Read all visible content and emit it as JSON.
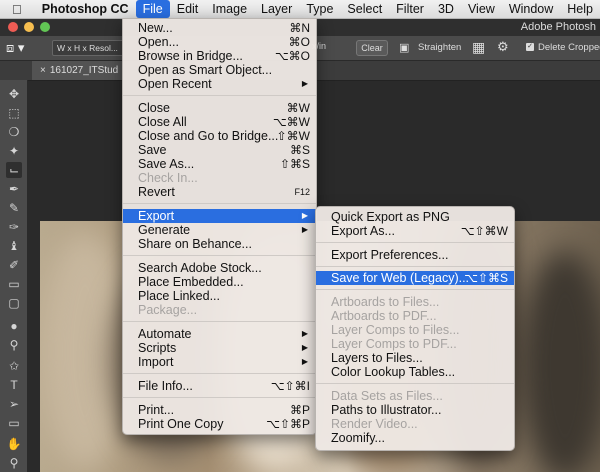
{
  "menubar": {
    "items": [
      "Photoshop CC",
      "File",
      "Edit",
      "Image",
      "Layer",
      "Type",
      "Select",
      "Filter",
      "3D",
      "View",
      "Window",
      "Help"
    ]
  },
  "window": {
    "title": "Adobe Photosh"
  },
  "options": {
    "ratio": "W x H x Resol...",
    "unit": "x/in",
    "clear": "Clear",
    "straighten": "Straighten",
    "delete_cropped": "Delete Cropped P"
  },
  "tab": {
    "title": "161027_ITStud"
  },
  "file_menu": [
    {
      "label": "New...",
      "shortcut": "⌘N"
    },
    {
      "label": "Open...",
      "shortcut": "⌘O"
    },
    {
      "label": "Browse in Bridge...",
      "shortcut": "⌥⌘O"
    },
    {
      "label": "Open as Smart Object...",
      "shortcut": ""
    },
    {
      "label": "Open Recent",
      "shortcut": "",
      "submenu": true
    },
    {
      "label": "Close",
      "shortcut": "⌘W"
    },
    {
      "label": "Close All",
      "shortcut": "⌥⌘W"
    },
    {
      "label": "Close and Go to Bridge...",
      "shortcut": "⇧⌘W"
    },
    {
      "label": "Save",
      "shortcut": "⌘S"
    },
    {
      "label": "Save As...",
      "shortcut": "⇧⌘S"
    },
    {
      "label": "Check In...",
      "shortcut": "",
      "disabled": true
    },
    {
      "label": "Revert",
      "shortcut": "F12"
    },
    {
      "label": "Export",
      "shortcut": "",
      "submenu": true,
      "highlighted": true
    },
    {
      "label": "Generate",
      "shortcut": "",
      "submenu": true
    },
    {
      "label": "Share on Behance...",
      "shortcut": ""
    },
    {
      "label": "Search Adobe Stock...",
      "shortcut": ""
    },
    {
      "label": "Place Embedded...",
      "shortcut": ""
    },
    {
      "label": "Place Linked...",
      "shortcut": ""
    },
    {
      "label": "Package...",
      "shortcut": "",
      "disabled": true
    },
    {
      "label": "Automate",
      "shortcut": "",
      "submenu": true
    },
    {
      "label": "Scripts",
      "shortcut": "",
      "submenu": true
    },
    {
      "label": "Import",
      "shortcut": "",
      "submenu": true
    },
    {
      "label": "File Info...",
      "shortcut": "⌥⇧⌘I"
    },
    {
      "label": "Print...",
      "shortcut": "⌘P"
    },
    {
      "label": "Print One Copy",
      "shortcut": "⌥⇧⌘P"
    }
  ],
  "export_menu": [
    {
      "label": "Quick Export as PNG",
      "shortcut": ""
    },
    {
      "label": "Export As...",
      "shortcut": "⌥⇧⌘W"
    },
    {
      "label": "Export Preferences...",
      "shortcut": ""
    },
    {
      "label": "Save for Web (Legacy)...",
      "shortcut": "⌥⇧⌘S",
      "highlighted": true
    },
    {
      "label": "Artboards to Files...",
      "shortcut": "",
      "disabled": true
    },
    {
      "label": "Artboards to PDF...",
      "shortcut": "",
      "disabled": true
    },
    {
      "label": "Layer Comps to Files...",
      "shortcut": "",
      "disabled": true
    },
    {
      "label": "Layer Comps to PDF...",
      "shortcut": "",
      "disabled": true
    },
    {
      "label": "Layers to Files...",
      "shortcut": ""
    },
    {
      "label": "Color Lookup Tables...",
      "shortcut": ""
    },
    {
      "label": "Data Sets as Files...",
      "shortcut": "",
      "disabled": true
    },
    {
      "label": "Paths to Illustrator...",
      "shortcut": ""
    },
    {
      "label": "Render Video...",
      "shortcut": "",
      "disabled": true
    },
    {
      "label": "Zoomify...",
      "shortcut": ""
    }
  ],
  "tools": [
    "move-icon",
    "marquee-icon",
    "lasso-icon",
    "quick-select-icon",
    "crop-icon",
    "eyedropper-icon",
    "healing-brush-icon",
    "brush-icon",
    "clone-stamp-icon",
    "history-brush-icon",
    "eraser-icon",
    "gradient-icon",
    "blur-icon",
    "dodge-icon",
    "pen-icon",
    "type-icon",
    "path-select-icon",
    "rectangle-icon",
    "hand-icon",
    "zoom-icon"
  ]
}
